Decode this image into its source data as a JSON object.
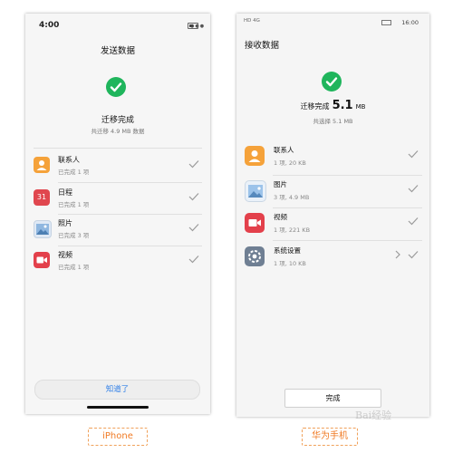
{
  "iphone": {
    "status_time": "4:00",
    "title": "发送数据",
    "done_text": "迁移完成",
    "summary": "共迁移 4.9 MB 数据",
    "items": [
      {
        "name": "联系人",
        "status": "已完成 1 项",
        "icon": "contacts-icon"
      },
      {
        "name": "日程",
        "status": "已完成 1 项",
        "icon": "calendar-icon",
        "icon_text": "31"
      },
      {
        "name": "照片",
        "status": "已完成 3 项",
        "icon": "photos-icon"
      },
      {
        "name": "视频",
        "status": "已完成 1 项",
        "icon": "video-icon"
      }
    ],
    "button_label": "知道了",
    "tag_label": "iPhone"
  },
  "huawei": {
    "status_left": "HD 4G",
    "status_time": "16:00",
    "title": "接收数据",
    "done_text": "迁移完成",
    "done_size": "5.1",
    "done_unit": "MB",
    "summary": "共选择 5.1 MB",
    "items": [
      {
        "name": "联系人",
        "detail": "1 项, 20 KB",
        "icon": "contacts-icon"
      },
      {
        "name": "图片",
        "detail": "3 项, 4.9 MB",
        "icon": "gallery-icon"
      },
      {
        "name": "视频",
        "detail": "1 项, 221 KB",
        "icon": "video-icon"
      },
      {
        "name": "系统设置",
        "detail": "1 项, 10 KB",
        "icon": "settings-icon"
      }
    ],
    "button_label": "完成",
    "tag_label": "华为手机"
  },
  "colors": {
    "success_green": "#1fb55c",
    "link_blue": "#2f7fe8",
    "tag_orange": "#f07a24",
    "contacts_orange": "#f5a23a",
    "calendar_red": "#e0474f",
    "video_red": "#e3404b"
  },
  "watermark": "Bai经验"
}
